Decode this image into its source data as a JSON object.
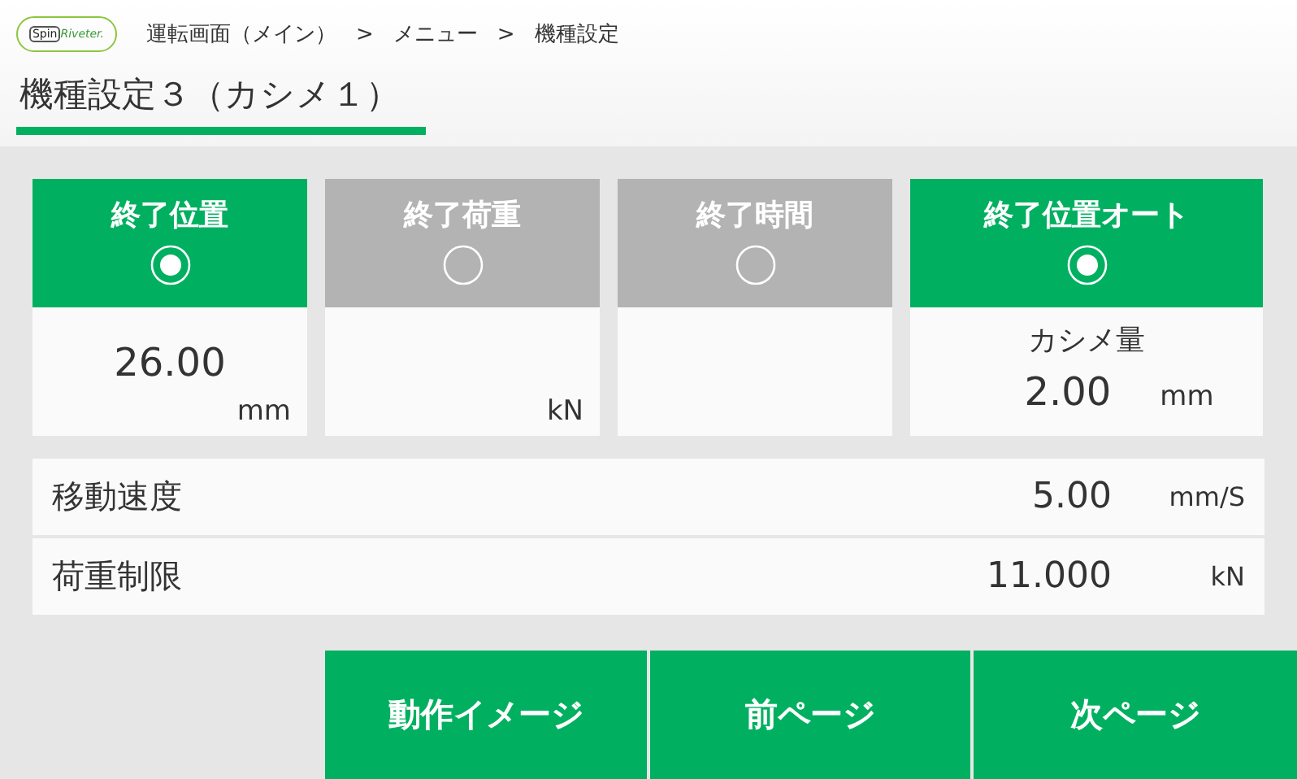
{
  "logo": {
    "mark": "Spin",
    "name": "Riveter."
  },
  "breadcrumb": [
    "運転画面（メイン）",
    "メニュー",
    "機種設定"
  ],
  "breadcrumb_separator": ">",
  "title": "機種設定３（カシメ１）",
  "modes": [
    {
      "label": "終了位置",
      "selected": true,
      "value": "26.00",
      "unit": "mm"
    },
    {
      "label": "終了荷重",
      "selected": false,
      "unit": "kN"
    },
    {
      "label": "終了時間",
      "selected": false
    },
    {
      "label": "終了位置オート",
      "selected": true,
      "caption": "カシメ量",
      "value": "2.00",
      "unit": "mm"
    }
  ],
  "settings": [
    {
      "label": "移動速度",
      "value": "5.00",
      "unit": "mm/S"
    },
    {
      "label": "荷重制限",
      "value": "11.000",
      "unit": "kN"
    }
  ],
  "buttons": [
    "動作イメージ",
    "前ページ",
    "次ページ"
  ]
}
